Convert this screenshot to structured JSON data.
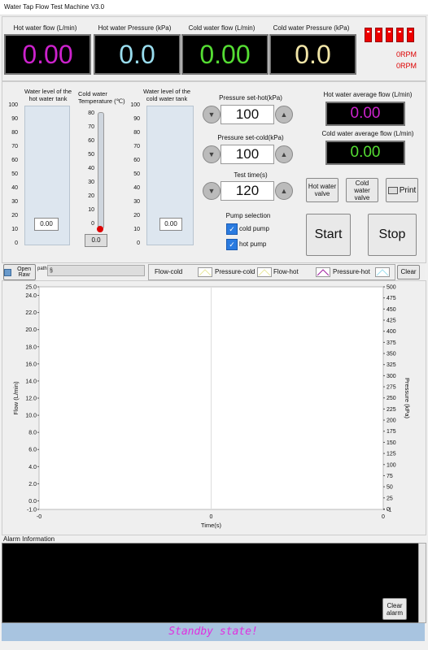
{
  "app": {
    "title": "Water Tap Flow Test Machine V3.0"
  },
  "meters": {
    "hot_flow": {
      "label": "Hot water flow (L/min)",
      "value": "0.00",
      "color": "#cc22cc"
    },
    "hot_pressure": {
      "label": "Hot water Pressure (kPa)",
      "value": "0.0",
      "color": "#99ddee"
    },
    "cold_flow": {
      "label": "Cold water flow (L/min)",
      "value": "0.00",
      "color": "#55dd33"
    },
    "cold_pressure": {
      "label": "Cold water Pressure (kPa)",
      "value": "0.0",
      "color": "#f2e6a8"
    }
  },
  "rpm": {
    "line1": "0RPM",
    "line2": "0RPM"
  },
  "tanks": {
    "hot_label": "Water level of the hot water tank",
    "hot_value": "0.00",
    "cold_label": "Water level of the cold water tank",
    "cold_value": "0.00",
    "scale": [
      "100",
      "90",
      "80",
      "70",
      "60",
      "50",
      "40",
      "30",
      "20",
      "10",
      "0"
    ]
  },
  "thermo": {
    "label": "Cold water Temperature (℃)",
    "scale": [
      "80",
      "70",
      "60",
      "50",
      "40",
      "30",
      "20",
      "10",
      "0"
    ],
    "value": "0.0"
  },
  "settings": {
    "pressure_hot_label": "Pressure set-hot(kPa)",
    "pressure_hot_value": "100",
    "pressure_cold_label": "Pressure set-cold(kPa)",
    "pressure_cold_value": "100",
    "test_time_label": "Test time(s)",
    "test_time_value": "120",
    "pump_label": "Pump selection",
    "cold_pump": "cold pump",
    "hot_pump": "hot pump"
  },
  "averages": {
    "hot_label": "Hot water average flow (L/min)",
    "hot_value": "0.00",
    "cold_label": "Cold water average flow (L/min)",
    "cold_value": "0.00"
  },
  "buttons": {
    "hot_valve": "Hot water valve",
    "cold_valve": "Cold water valve",
    "print": "Print",
    "start": "Start",
    "stop": "Stop",
    "open_raw": "Open Raw",
    "clear": "Clear",
    "clear_alarm": "Clear alarm"
  },
  "path": {
    "label": "path",
    "value": "§"
  },
  "legend": [
    "Flow-cold",
    "Pressure-cold",
    "Flow-hot",
    "Pressure-hot"
  ],
  "legend_colors": [
    "#ffffff",
    "#e8e8a0",
    "#ffffff",
    "#a020a0"
  ],
  "chart_data": {
    "type": "line",
    "series": [],
    "xlabel": "Time(s)",
    "ylabel": "Flow (L/min)",
    "y2label": "Pressure (kPa)",
    "xlim": [
      0,
      0
    ],
    "x_ticks": [
      "-0",
      "0",
      "0"
    ],
    "ylim": [
      -1.0,
      25.0
    ],
    "y_ticks": [
      "25.0",
      "24.0",
      "22.0",
      "20.0",
      "18.0",
      "16.0",
      "14.0",
      "12.0",
      "10.0",
      "8.0",
      "6.0",
      "4.0",
      "2.0",
      "0.0",
      "-1.0"
    ],
    "y2lim": [
      -1,
      500
    ],
    "y2_ticks": [
      "500",
      "475",
      "450",
      "425",
      "400",
      "375",
      "350",
      "325",
      "300",
      "275",
      "250",
      "225",
      "200",
      "175",
      "150",
      "125",
      "100",
      "75",
      "50",
      "25",
      "0",
      "-1"
    ],
    "grid": true
  },
  "alarm": {
    "label": "Alarm Information"
  },
  "status": {
    "text": "Standby state!"
  }
}
